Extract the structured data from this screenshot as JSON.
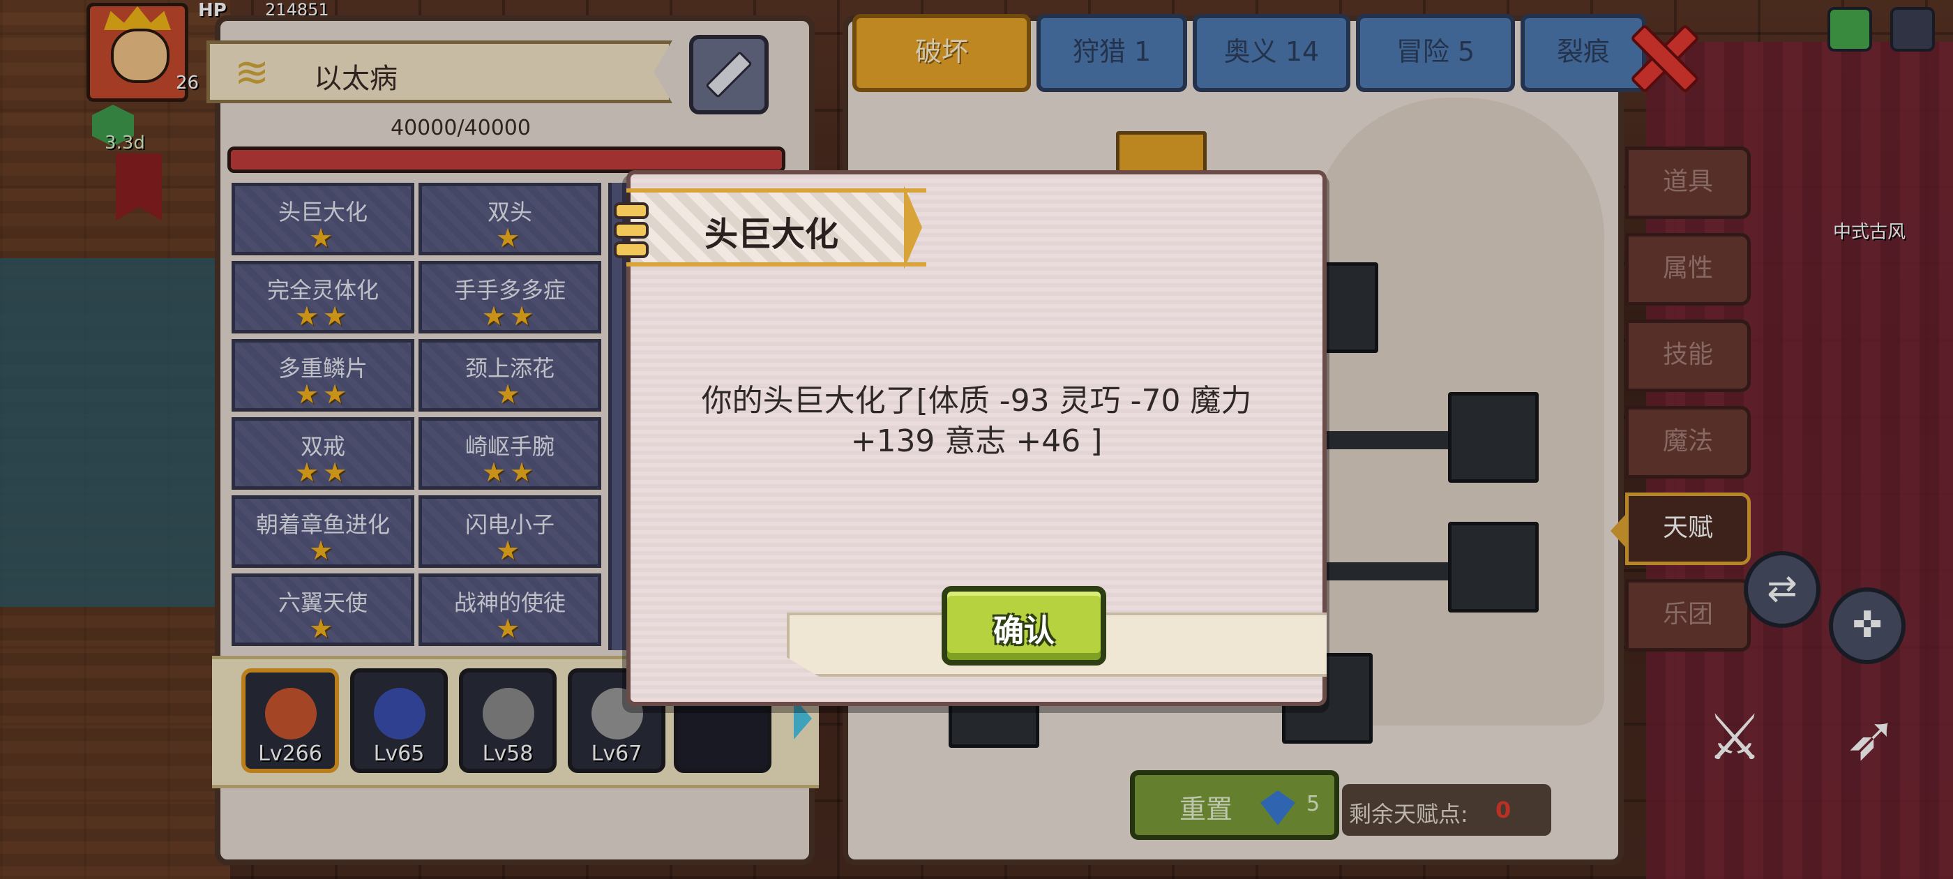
{
  "hero": {
    "hp_label": "HP",
    "hp_value": "214851",
    "level": "26",
    "time": "3.3d"
  },
  "ailment": {
    "title": "以太病",
    "hp_text": "40000/40000",
    "hp_fraction": 1.0,
    "traits": [
      {
        "label": "头巨大化",
        "stars": "★"
      },
      {
        "label": "双头",
        "stars": "★"
      },
      {
        "label": "完全灵体化",
        "stars": "★★"
      },
      {
        "label": "手手多多症",
        "stars": "★★"
      },
      {
        "label": "多重鳞片",
        "stars": "★★"
      },
      {
        "label": "颈上添花",
        "stars": "★"
      },
      {
        "label": "双戒",
        "stars": "★★"
      },
      {
        "label": "崎岖手腕",
        "stars": "★★"
      },
      {
        "label": "朝着章鱼进化",
        "stars": "★"
      },
      {
        "label": "闪电小子",
        "stars": "★"
      },
      {
        "label": "六翼天使",
        "stars": "★"
      },
      {
        "label": "战神的使徒",
        "stars": "★"
      }
    ]
  },
  "team": [
    {
      "level": "Lv266",
      "color": "#c9562f",
      "selected": true
    },
    {
      "level": "Lv65",
      "color": "#3b4fb0",
      "selected": false
    },
    {
      "level": "Lv58",
      "color": "#8a8a8a",
      "selected": false
    },
    {
      "level": "Lv67",
      "color": "#9a9a9a",
      "selected": false
    }
  ],
  "tabs": [
    {
      "label": "破坏",
      "active": true
    },
    {
      "label": "狩猎 1",
      "active": false
    },
    {
      "label": "奥义 14",
      "active": false
    },
    {
      "label": "冒险 5",
      "active": false
    },
    {
      "label": "裂痕",
      "active": false
    }
  ],
  "side_menu": [
    {
      "label": "道具",
      "active": false
    },
    {
      "label": "属性",
      "active": false
    },
    {
      "label": "技能",
      "active": false
    },
    {
      "label": "魔法",
      "active": false
    },
    {
      "label": "天赋",
      "active": true
    },
    {
      "label": "乐团",
      "active": false
    }
  ],
  "talent": {
    "reset_label": "重置",
    "reset_cost": "5",
    "points_label": "剩余天赋点:",
    "points_value": "0"
  },
  "decor": {
    "shop_label": "中式古风"
  },
  "dialog": {
    "title": "头巨大化",
    "message": "你的头巨大化了[体质 -93 灵巧 -70   魔力 +139 意志 +46 ]",
    "confirm_label": "确认"
  },
  "colors": {
    "confirm_green": "#b6d23e",
    "active_tab": "#e8a52a",
    "inactive_tab": "#4f7ab2",
    "hp_red": "#c23c3c",
    "star_gold": "#f3b31d",
    "points_red": "#e53b2e"
  },
  "icons": {
    "ailment": "wind-swirl-icon",
    "medicine": "syringe-icon",
    "close": "close-x-icon",
    "gem": "blue-gem-icon"
  }
}
